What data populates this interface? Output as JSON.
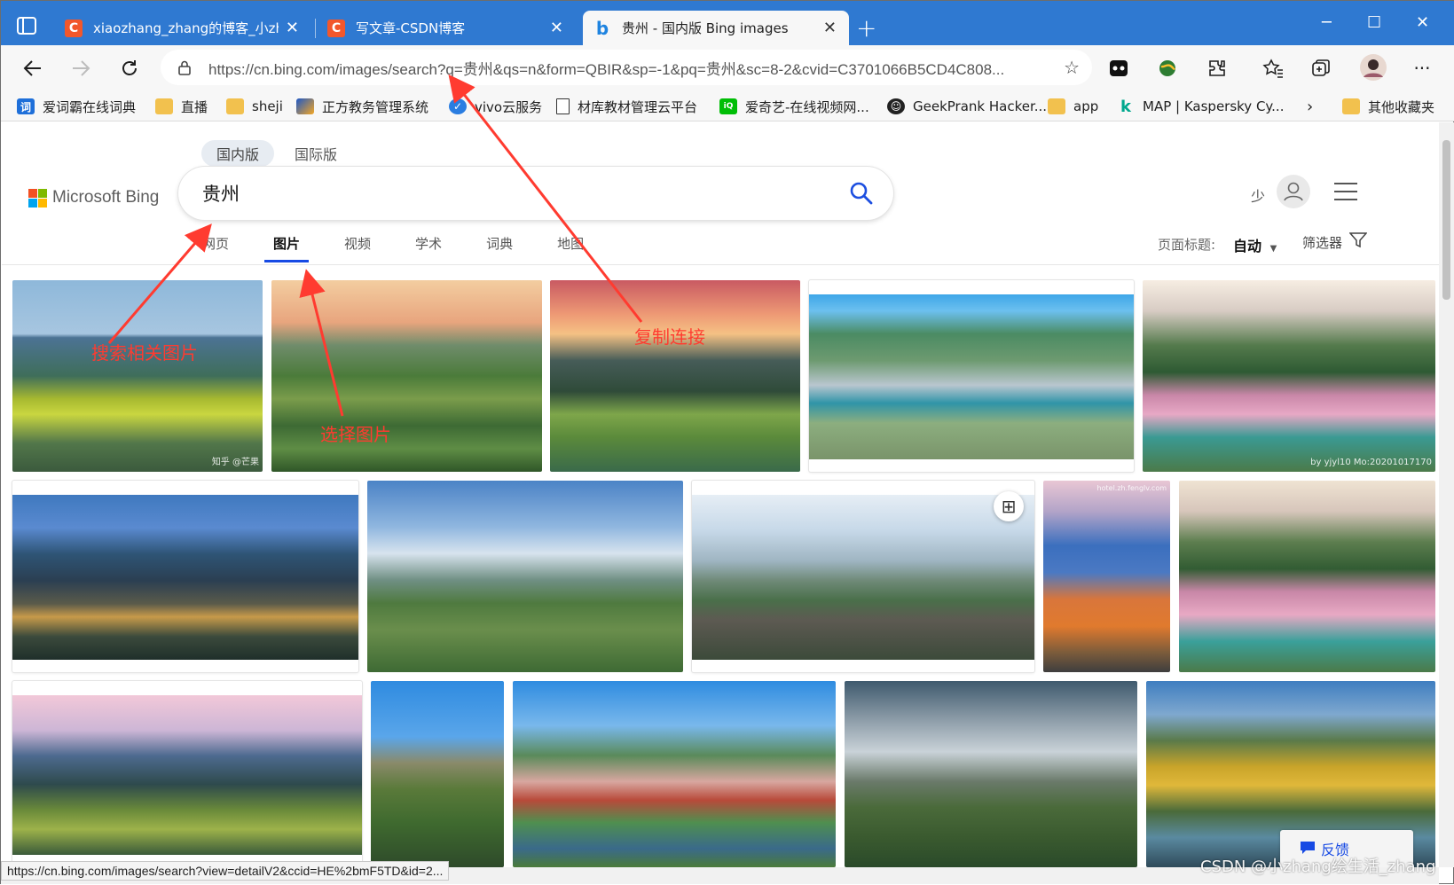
{
  "colors": {
    "chrome": "#2f79d1",
    "accent": "#174ae4",
    "annotation": "#ff3b30"
  },
  "tabs": [
    {
      "label": "xiaozhang_zhang的博客_小zhang",
      "favicon": "csdn-icon",
      "favicon_text": "C"
    },
    {
      "label": "写文章-CSDN博客",
      "favicon": "csdn-icon",
      "favicon_text": "C"
    },
    {
      "label": "贵州 - 国内版 Bing images",
      "favicon": "bing-icon",
      "favicon_text": "b"
    }
  ],
  "address": {
    "url": "https://cn.bing.com/images/search?q=贵州&qs=n&form=QBIR&sp=-1&pq=贵州&sc=8-2&cvid=C3701066B5CD4C808..."
  },
  "bookmarks": [
    {
      "label": "爱词霸在线词典",
      "icon": "iciba-icon"
    },
    {
      "label": "直播",
      "icon": "folder-icon"
    },
    {
      "label": "sheji",
      "icon": "folder-icon"
    },
    {
      "label": "正方教务管理系统",
      "icon": "zf-icon"
    },
    {
      "label": "vivo云服务",
      "icon": "vivo-icon"
    },
    {
      "label": "材库教材管理云平台",
      "icon": "page-icon"
    },
    {
      "label": "爱奇艺-在线视频网...",
      "icon": "iqiyi-icon"
    },
    {
      "label": "GeekPrank Hacker...",
      "icon": "geekprank-icon"
    },
    {
      "label": "app",
      "icon": "folder-icon"
    },
    {
      "label": "MAP | Kaspersky Cy...",
      "icon": "kaspersky-icon"
    },
    {
      "label": "其他收藏夹",
      "icon": "folder-icon"
    }
  ],
  "bing": {
    "region_tabs": [
      "国内版",
      "国际版"
    ],
    "logo_text": "Microsoft Bing",
    "query": "贵州",
    "rewards_text": "少",
    "verticals": [
      "网页",
      "图片",
      "视频",
      "学术",
      "词典",
      "地图"
    ],
    "page_title_label": "页面标题:",
    "page_title_value": "自动",
    "filter_label": "筛选器",
    "feedback_label": "反馈"
  },
  "tiles": [
    {
      "desc": "karst-valley",
      "watermark": "知乎 @芒果"
    },
    {
      "desc": "rice-terraces"
    },
    {
      "desc": "mountain-meadow"
    },
    {
      "desc": "river-town"
    },
    {
      "desc": "pink-park",
      "watermark": "by yjyl10 Mo:20201017170"
    },
    {
      "desc": "night-village"
    },
    {
      "desc": "green-hills"
    },
    {
      "desc": "miao-village"
    },
    {
      "desc": "mountain-road",
      "watermark": "hotel.zh.fenglv.com"
    },
    {
      "desc": "pink-park-2"
    },
    {
      "desc": "karst-dusk"
    },
    {
      "desc": "fanjing-rock"
    },
    {
      "desc": "city-aerial"
    },
    {
      "desc": "misty-peak"
    },
    {
      "desc": "autumn-lake"
    }
  ],
  "annotations": {
    "search_related": "搜索相关图片",
    "choose_image": "选择图片",
    "copy_link": "复制连接"
  },
  "status": {
    "link": "https://cn.bing.com/images/search?view=detailV2&ccid=HE%2bmF5TD&id=2..."
  },
  "watermark": "CSDN @小zhang绘生活_zhang"
}
